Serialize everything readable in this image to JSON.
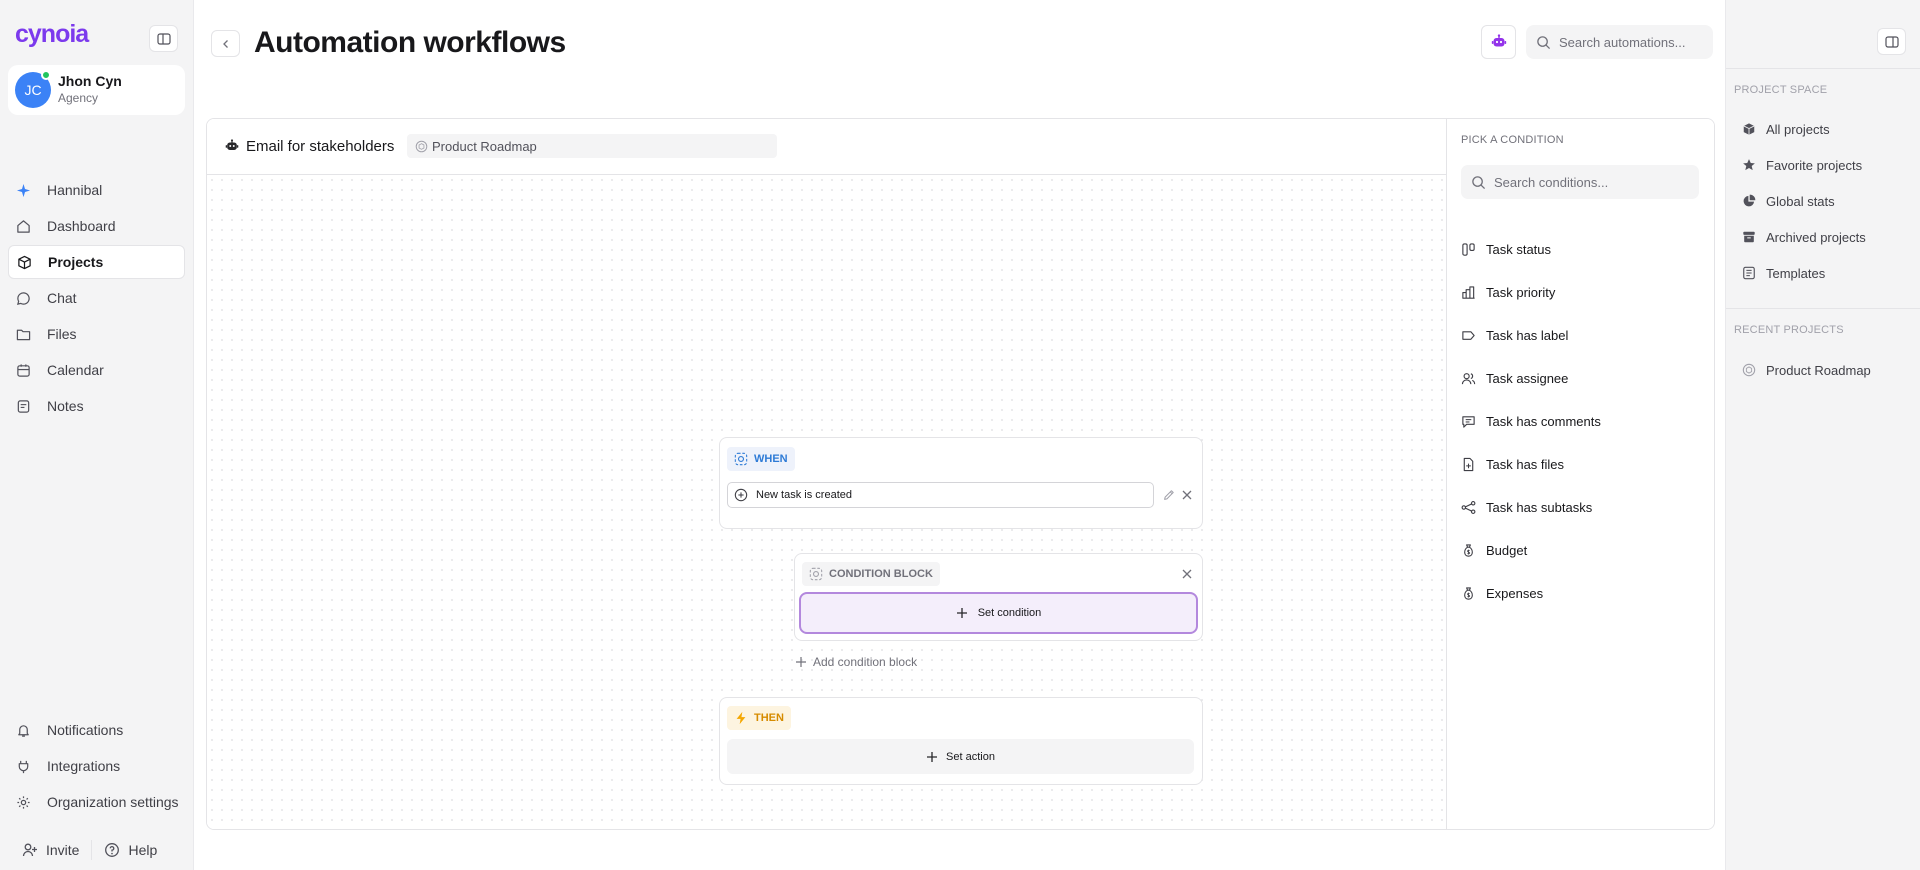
{
  "app": {
    "logo_text": "cynoia"
  },
  "user": {
    "initials": "JC",
    "name": "Jhon Cyn",
    "role": "Agency"
  },
  "nav": {
    "items": [
      {
        "label": "Hannibal",
        "icon": "sparkle-icon"
      },
      {
        "label": "Dashboard",
        "icon": "home-icon"
      },
      {
        "label": "Projects",
        "icon": "cube-icon",
        "active": true
      },
      {
        "label": "Chat",
        "icon": "chat-icon"
      },
      {
        "label": "Files",
        "icon": "folder-icon"
      },
      {
        "label": "Calendar",
        "icon": "calendar-icon"
      },
      {
        "label": "Notes",
        "icon": "notes-icon"
      }
    ],
    "bottom_items": [
      {
        "label": "Notifications",
        "icon": "bell-icon"
      },
      {
        "label": "Integrations",
        "icon": "plug-icon"
      },
      {
        "label": "Organization settings",
        "icon": "gear-icon"
      }
    ],
    "invite_label": "Invite",
    "help_label": "Help"
  },
  "header": {
    "title": "Automation workflows",
    "search_placeholder": "Search automations..."
  },
  "workflow": {
    "name": "Email for stakeholders",
    "project": "Product Roadmap",
    "when_tag": "WHEN",
    "trigger": "New task is created",
    "condition_tag": "CONDITION BLOCK",
    "set_condition_label": "Set condition",
    "add_condition_label": "Add condition block",
    "then_tag": "THEN",
    "set_action_label": "Set action"
  },
  "condition_panel": {
    "label": "PICK A CONDITION",
    "search_placeholder": "Search conditions...",
    "items": [
      {
        "label": "Task status",
        "icon": "status-icon"
      },
      {
        "label": "Task priority",
        "icon": "bar-chart-icon"
      },
      {
        "label": "Task has label",
        "icon": "label-icon"
      },
      {
        "label": "Task assignee",
        "icon": "users-icon"
      },
      {
        "label": "Task has comments",
        "icon": "comment-icon"
      },
      {
        "label": "Task has files",
        "icon": "file-icon"
      },
      {
        "label": "Task has subtasks",
        "icon": "subtasks-icon"
      },
      {
        "label": "Budget",
        "icon": "money-bag-icon"
      },
      {
        "label": "Expenses",
        "icon": "money-bag-icon"
      }
    ]
  },
  "right_sidebar": {
    "project_space_label": "PROJECT SPACE",
    "project_space_items": [
      {
        "label": "All projects",
        "icon": "cube-icon"
      },
      {
        "label": "Favorite projects",
        "icon": "star-icon"
      },
      {
        "label": "Global stats",
        "icon": "pie-chart-icon"
      },
      {
        "label": "Archived projects",
        "icon": "archive-icon"
      },
      {
        "label": "Templates",
        "icon": "template-icon"
      }
    ],
    "recent_projects_label": "RECENT PROJECTS",
    "recent_projects": [
      {
        "label": "Product Roadmap",
        "icon": "project-icon"
      }
    ]
  },
  "colors": {
    "brand": "#7c3aed",
    "when": "#2e7bd6",
    "then": "#d68b00",
    "condition_highlight": "#b388dd",
    "avatar": "#3b82f6",
    "online": "#22c55e"
  }
}
